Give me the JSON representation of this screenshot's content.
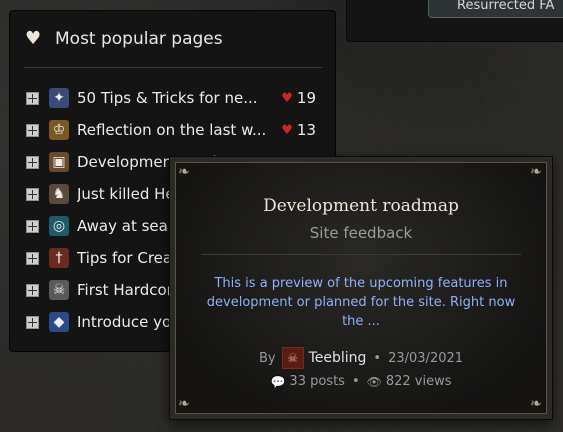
{
  "top_tag": {
    "label": "Resurrected FA"
  },
  "popular": {
    "title": "Most popular pages",
    "items": [
      {
        "title": "50 Tips & Tricks for ne...",
        "likes": "19",
        "icon": "tips-icon",
        "color": "#3a4a7a"
      },
      {
        "title": "Reflection on the last w...",
        "likes": "13",
        "icon": "reflection-icon",
        "color": "#7a5a20"
      },
      {
        "title": "Development roadmap",
        "likes": "",
        "icon": "chest-icon",
        "color": "#6a4a2a"
      },
      {
        "title": "Just killed Hell Diablo",
        "likes": "",
        "icon": "horse-icon",
        "color": "#5a4a3a"
      },
      {
        "title": "Away at sea",
        "likes": "",
        "icon": "wave-icon",
        "color": "#1f5a6a"
      },
      {
        "title": "Tips for Creating Guides",
        "likes": "",
        "icon": "sword-icon",
        "color": "#6a2a20"
      },
      {
        "title": "First Hardcore run",
        "likes": "",
        "icon": "skull-icon",
        "color": "#5a5a5a"
      },
      {
        "title": "Introduce yourself",
        "likes": "",
        "icon": "gem-icon",
        "color": "#2a4a8a"
      }
    ]
  },
  "tooltip": {
    "title": "Development roadmap",
    "category": "Site feedback",
    "preview": "This is a preview of the upcoming features in development or planned for the site. Right now the ...",
    "by_label": "By",
    "author": "Teebling",
    "date": "23/03/2021",
    "posts": "33 posts",
    "views": "822 views"
  }
}
